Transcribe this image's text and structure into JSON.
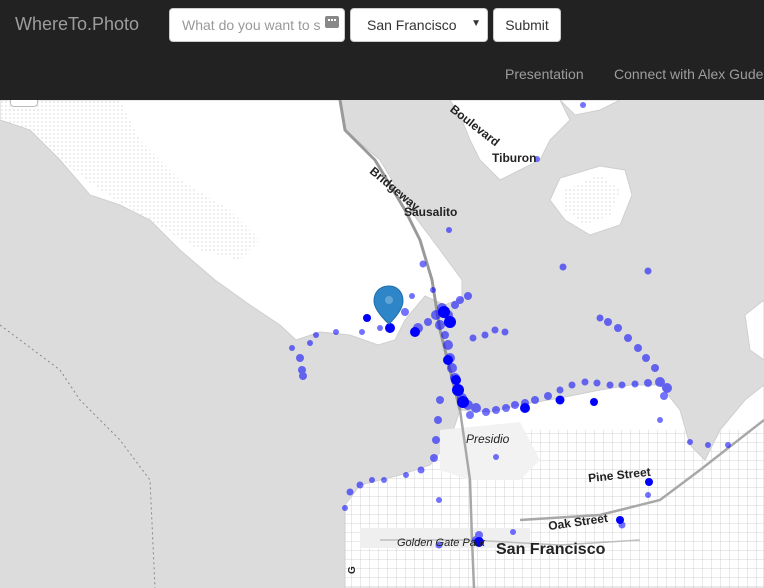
{
  "navbar": {
    "brand": "WhereTo.Photo",
    "search_placeholder": "What do you want to see",
    "city_selected": "San Francisco",
    "submit_label": "Submit",
    "links": [
      "Presentation",
      "Connect with Alex Gude"
    ]
  },
  "map": {
    "labels": {
      "boulevard": "Boulevard",
      "tiburon": "Tiburon",
      "bridgeway": "Bridgeway",
      "sausalito": "Sausalito",
      "presidio": "Presidio",
      "pine_street": "Pine Street",
      "oak_street": "Oak Street",
      "golden_gate_park": "Golden Gate Park",
      "san_francisco": "San Francisco",
      "edge_letter": "G"
    },
    "colors": {
      "water": "#dcdcdc",
      "land": "#ffffff",
      "photo_dot": "#0000ff",
      "marker": "#2e86c8"
    }
  }
}
